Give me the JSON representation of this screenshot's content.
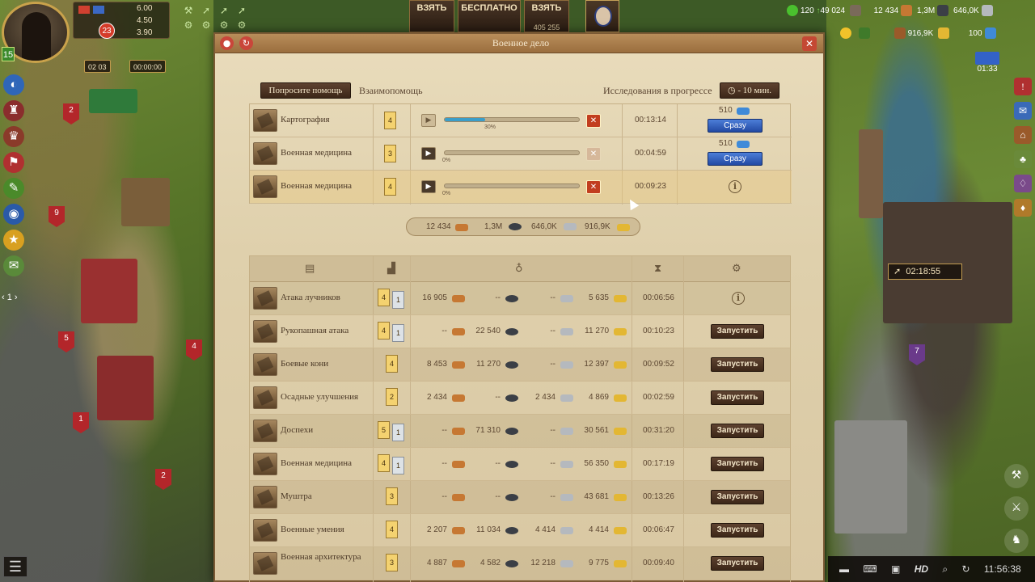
{
  "hud": {
    "player_level": "15",
    "res_values": [
      "6.00",
      "4.50",
      "3.90"
    ],
    "notifications": "23",
    "timer_left": "02 03",
    "timer_right": "00:00:00",
    "btn_take1": "ВЗЯТЬ",
    "btn_free": "БЕСПЛАТНО",
    "btn_take2": "ВЗЯТЬ",
    "btn_take2_sub": "405 255"
  },
  "top_right": {
    "pop": "120",
    "pop_growth": "49 024",
    "wood": "12 434",
    "stone": "1,3M",
    "iron": "646,0K",
    "gold": "916,9K",
    "gems": "100",
    "news_time": "01:33"
  },
  "left_pager": "1",
  "map_timer": "02:18:55",
  "bottom_bar": {
    "hd": "HD",
    "time": "11:56:38"
  },
  "modal": {
    "title": "Военное дело",
    "help_btn": "Попросите помощь",
    "mutual": "Взаимопомощь",
    "in_progress": "Исследования в прогрессе",
    "time_btn": "- 10 мин."
  },
  "queue": [
    {
      "name": "Картография",
      "level": "4",
      "progress": 30,
      "pct": "30%",
      "time": "00:13:14",
      "price": "510",
      "action": "Сразу",
      "active": true,
      "cancel_dim": false
    },
    {
      "name": "Военная медицина",
      "level": "3",
      "progress": 0,
      "pct": "0%",
      "time": "00:04:59",
      "price": "510",
      "action": "Сразу",
      "active": false,
      "cancel_dim": true
    },
    {
      "name": "Военная медицина",
      "level": "4",
      "progress": 0,
      "pct": "0%",
      "time": "00:09:23",
      "price": "",
      "action": "",
      "active": false,
      "cancel_dim": false
    }
  ],
  "summary": {
    "wood": "12 434",
    "stone": "1,3M",
    "iron": "646,0K",
    "gold": "916,9K"
  },
  "table": {
    "launch_label": "Запустить",
    "rows": [
      {
        "name": "Атака лучников",
        "lvl": "4",
        "lvl2": "1",
        "wood": "16 905",
        "stone": "--",
        "iron": "--",
        "gold": "5 635",
        "time": "00:06:56",
        "action": "info"
      },
      {
        "name": "Рукопашная атака",
        "lvl": "4",
        "lvl2": "1",
        "wood": "--",
        "stone": "22 540",
        "iron": "--",
        "gold": "11 270",
        "time": "00:10:23",
        "action": "launch"
      },
      {
        "name": "Боевые кони",
        "lvl": "4",
        "lvl2": "",
        "wood": "8 453",
        "stone": "11 270",
        "iron": "--",
        "gold": "12 397",
        "time": "00:09:52",
        "action": "launch"
      },
      {
        "name": "Осадные улучшения",
        "lvl": "2",
        "lvl2": "",
        "wood": "2 434",
        "stone": "--",
        "iron": "2 434",
        "gold": "4 869",
        "time": "00:02:59",
        "action": "launch"
      },
      {
        "name": "Доспехи",
        "lvl": "5",
        "lvl2": "1",
        "wood": "--",
        "stone": "71 310",
        "iron": "--",
        "gold": "30 561",
        "time": "00:31:20",
        "action": "launch"
      },
      {
        "name": "Военная медицина",
        "lvl": "4",
        "lvl2": "1",
        "wood": "--",
        "stone": "--",
        "iron": "--",
        "gold": "56 350",
        "time": "00:17:19",
        "action": "launch"
      },
      {
        "name": "Муштра",
        "lvl": "3",
        "lvl2": "",
        "wood": "--",
        "stone": "--",
        "iron": "--",
        "gold": "43 681",
        "time": "00:13:26",
        "action": "launch"
      },
      {
        "name": "Военные умения",
        "lvl": "4",
        "lvl2": "",
        "wood": "2 207",
        "stone": "11 034",
        "iron": "4 414",
        "gold": "4 414",
        "time": "00:06:47",
        "action": "launch"
      },
      {
        "name": "Военная архитектура",
        "lvl": "3",
        "lvl2": "",
        "wood": "4 887",
        "stone": "4 582",
        "iron": "12 218",
        "gold": "9 775",
        "time": "00:09:40",
        "action": "launch"
      }
    ]
  }
}
